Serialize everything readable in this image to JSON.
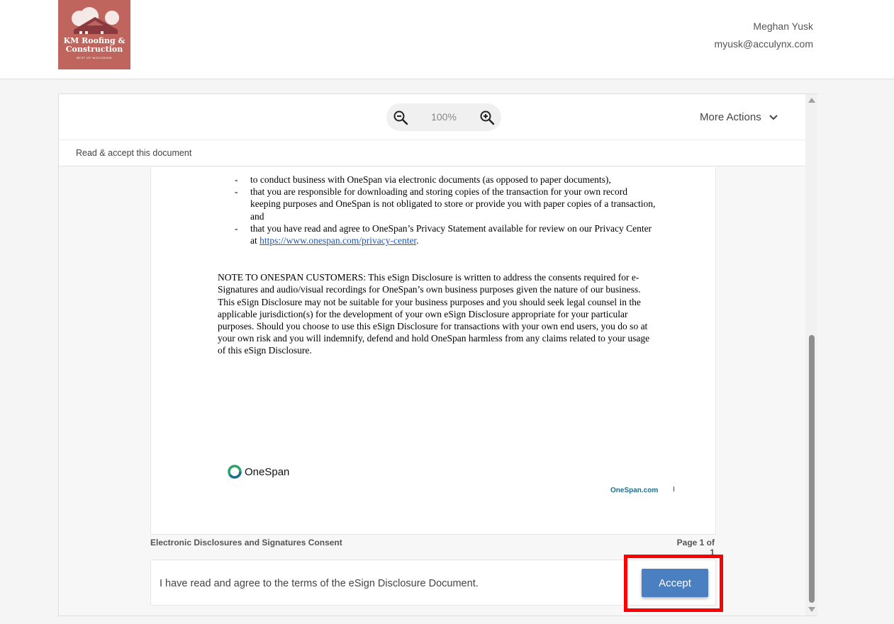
{
  "header": {
    "logo_text": "KM Roofing & Construction",
    "logo_sub": "BEST OF WISCONSIN",
    "user_name": "Meghan Yusk",
    "user_email": "myusk@acculynx.com"
  },
  "toolbar": {
    "zoom_level": "100%",
    "more_actions": "More Actions"
  },
  "subbar": {
    "title": "Read & accept this document"
  },
  "document": {
    "bullets": [
      "to conduct business with OneSpan via electronic documents (as opposed to paper documents),",
      "that you are responsible for downloading and storing copies of the transaction for your own record keeping purposes and OneSpan is not obligated to store or provide you with paper copies of a transaction, and"
    ],
    "last_bullet_prefix": "that you have read and agree to OneSpan’s Privacy Statement available for review on our Privacy Center at",
    "privacy_link": "https://www.onespan.com/privacy-center",
    "note": "NOTE TO ONESPAN CUSTOMERS: This eSign Disclosure is written to address the consents required for e-Signatures and audio/visual recordings for OneSpan’s own business purposes given the nature of our business. This eSign Disclosure may not be suitable for your business purposes and you should seek legal counsel in the applicable jurisdiction(s) for the development of your own eSign Disclosure appropriate for your particular purposes. Should you choose to use this eSign Disclosure for transactions with your own end users, you do so at your own risk and you will indemnify, defend and hold OneSpan harmless from any claims related to your usage of this eSign Disclosure.",
    "brand_name": "OneSpan",
    "footer_site": "OneSpan.com",
    "footer_tick": "I"
  },
  "caption": {
    "title": "Electronic Disclosures and Signatures Consent",
    "page": "Page 1 of 1"
  },
  "accept": {
    "statement": "I have read and agree to the terms of the eSign Disclosure Document.",
    "button": "Accept"
  },
  "colors": {
    "logo_bg": "#c0655d",
    "accept_button": "#4a7fc1",
    "highlight": "#ff0000",
    "link": "#1f57b5",
    "onespan_teal": "#1e6e8c"
  }
}
